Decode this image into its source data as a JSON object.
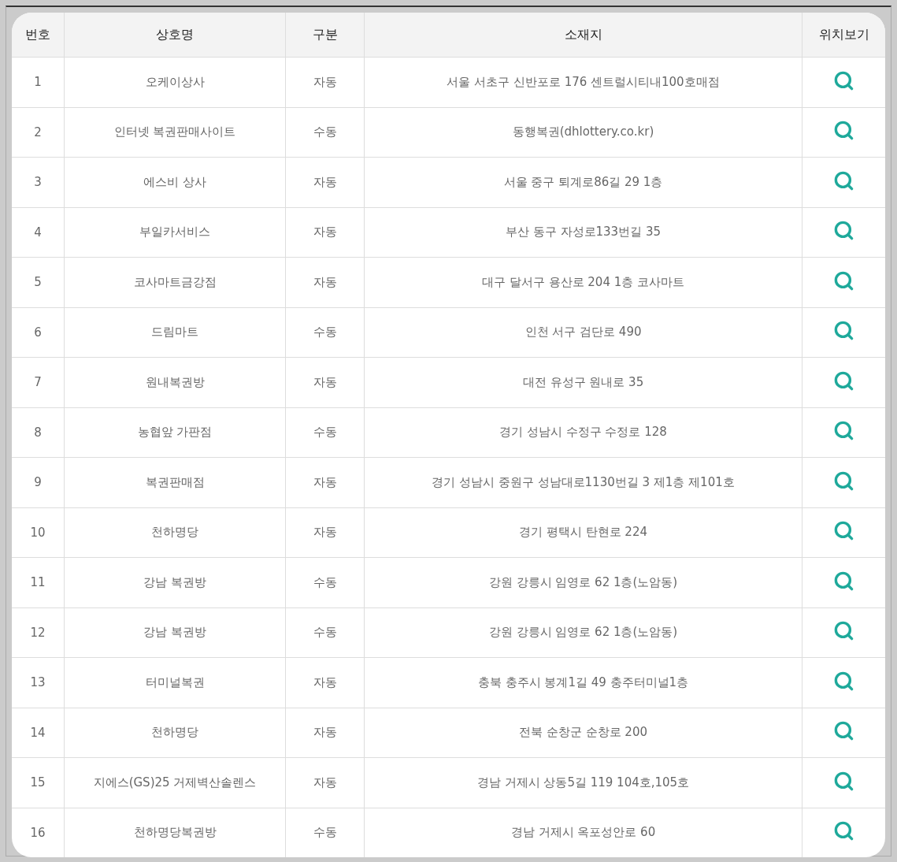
{
  "table": {
    "columns": [
      "번호",
      "상호명",
      "구분",
      "소재지",
      "위치보기"
    ],
    "rows": [
      {
        "no": "1",
        "name": "오케이상사",
        "type": "자동",
        "address": "서울 서초구 신반포로 176 센트럴시티내100호매점"
      },
      {
        "no": "2",
        "name": "인터넷 복권판매사이트",
        "type": "수동",
        "address": "동행복권(dhlottery.co.kr)"
      },
      {
        "no": "3",
        "name": "에스비 상사",
        "type": "자동",
        "address": "서울 중구 퇴계로86길 29 1층"
      },
      {
        "no": "4",
        "name": "부일카서비스",
        "type": "자동",
        "address": "부산 동구 자성로133번길 35"
      },
      {
        "no": "5",
        "name": "코사마트금강점",
        "type": "자동",
        "address": "대구 달서구 용산로 204 1층 코사마트"
      },
      {
        "no": "6",
        "name": "드림마트",
        "type": "수동",
        "address": "인천 서구 검단로 490"
      },
      {
        "no": "7",
        "name": "원내복권방",
        "type": "자동",
        "address": "대전 유성구 원내로 35"
      },
      {
        "no": "8",
        "name": "농협앞 가판점",
        "type": "수동",
        "address": "경기 성남시 수정구 수정로 128"
      },
      {
        "no": "9",
        "name": "복권판매점",
        "type": "자동",
        "address": "경기 성남시 중원구 성남대로1130번길 3 제1층 제101호"
      },
      {
        "no": "10",
        "name": "천하명당",
        "type": "자동",
        "address": "경기 평택시 탄현로 224"
      },
      {
        "no": "11",
        "name": "강남 복권방",
        "type": "수동",
        "address": "강원 강릉시 임영로 62 1층(노암동)"
      },
      {
        "no": "12",
        "name": "강남 복권방",
        "type": "수동",
        "address": "강원 강릉시 임영로 62 1층(노암동)"
      },
      {
        "no": "13",
        "name": "터미널복권",
        "type": "자동",
        "address": "충북 충주시 봉계1길 49 충주터미널1층"
      },
      {
        "no": "14",
        "name": "천하명당",
        "type": "자동",
        "address": "전북 순창군 순창로 200"
      },
      {
        "no": "15",
        "name": "지에스(GS)25 거제벽산솔렌스",
        "type": "자동",
        "address": "경남 거제시 상동5길 119 104호,105호"
      },
      {
        "no": "16",
        "name": "천하명당복권방",
        "type": "수동",
        "address": "경남 거제시 옥포성안로 60"
      }
    ]
  }
}
